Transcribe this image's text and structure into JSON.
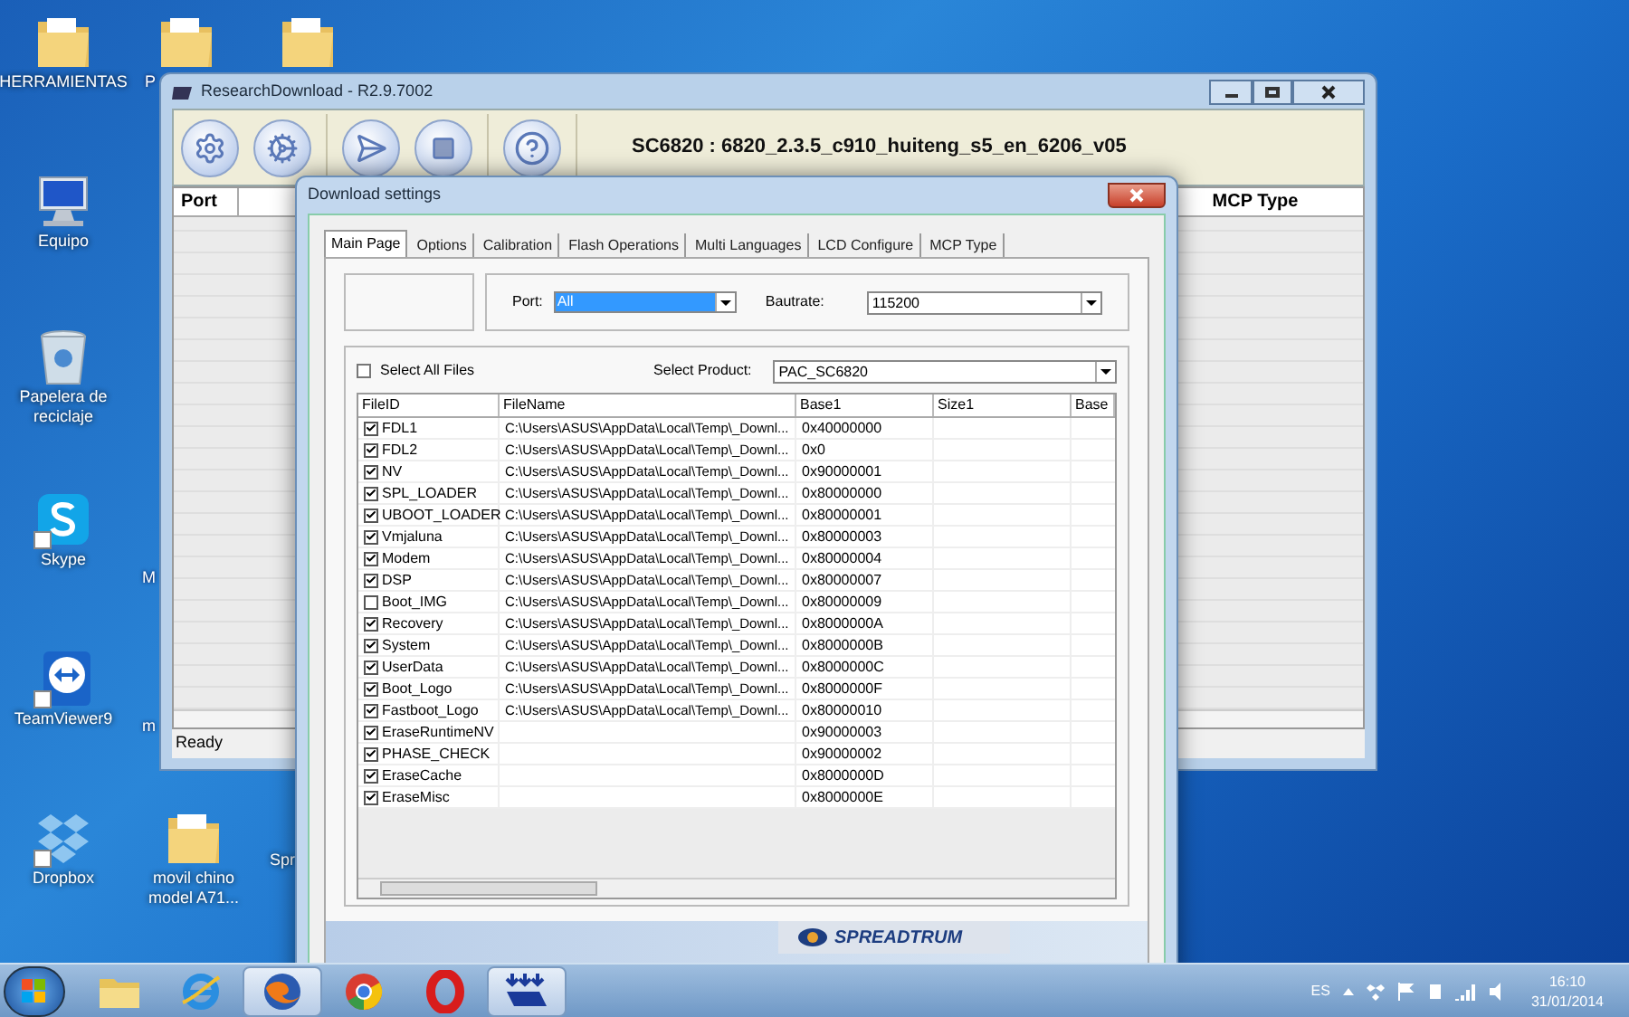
{
  "desktop_icons": [
    {
      "label": "HERRAMIENTAS",
      "kind": "folder-m"
    },
    {
      "label": "Equipo",
      "kind": "computer"
    },
    {
      "label": "Papelera de reciclaje",
      "kind": "recycle-bin"
    },
    {
      "label": "Skype",
      "kind": "skype"
    },
    {
      "label": "TeamViewer9",
      "kind": "teamviewer"
    },
    {
      "label": "Dropbox",
      "kind": "dropbox"
    }
  ],
  "desktop_icons_column_2": [
    {
      "label": "P",
      "kind": "folder"
    },
    {
      "label": "M",
      "kind": "none"
    },
    {
      "label": "m",
      "kind": "none"
    },
    {
      "label": "movil chino model A71...",
      "kind": "folder"
    }
  ],
  "desktop_icons_column_3": [
    {
      "kind": "folder"
    },
    {
      "label": "Spr",
      "kind": "none"
    }
  ],
  "main_window": {
    "title": "ResearchDownload - R2.9.7002",
    "toolbar": [
      {
        "kind": "settings"
      },
      {
        "kind": "gears"
      },
      {
        "kind": "start"
      },
      {
        "kind": "stop"
      },
      {
        "kind": "help"
      }
    ],
    "product_info": "SC6820 : 6820_2.3.5_c910_huiteng_s5_en_6206_v05",
    "columns": [
      "Port",
      "MCP Type"
    ],
    "status_bar": "Ready"
  },
  "dialog": {
    "title": "Download settings",
    "tabs": [
      {
        "label": "Main Page",
        "selected": true
      },
      {
        "label": "Options",
        "selected": false
      },
      {
        "label": "Calibration",
        "selected": false
      },
      {
        "label": "Flash Operations",
        "selected": false
      },
      {
        "label": "Multi Languages",
        "selected": false
      },
      {
        "label": "LCD Configure",
        "selected": false
      },
      {
        "label": "MCP Type",
        "selected": false
      }
    ],
    "port": {
      "label": "Port:",
      "value": "All"
    },
    "baudrate": {
      "label": "Bautrate:",
      "value": "115200"
    },
    "select_all": {
      "label": "Select All Files",
      "checked": false
    },
    "product": {
      "label": "Select Product:",
      "value": "PAC_SC6820"
    },
    "table": {
      "columns": [
        "FileID",
        "FileName",
        "Base1",
        "Size1",
        "Base"
      ],
      "rows": [
        {
          "file_id": "FDL1",
          "checked": true,
          "file_name": "C:\\Users\\ASUS\\AppData\\Local\\Temp\\_Downl...",
          "base1": "0x40000000"
        },
        {
          "file_id": "FDL2",
          "checked": true,
          "file_name": "C:\\Users\\ASUS\\AppData\\Local\\Temp\\_Downl...",
          "base1": "0x0"
        },
        {
          "file_id": "NV",
          "checked": true,
          "file_name": "C:\\Users\\ASUS\\AppData\\Local\\Temp\\_Downl...",
          "base1": "0x90000001"
        },
        {
          "file_id": "SPL_LOADER",
          "checked": true,
          "file_name": "C:\\Users\\ASUS\\AppData\\Local\\Temp\\_Downl...",
          "base1": "0x80000000"
        },
        {
          "file_id": "UBOOT_LOADER",
          "checked": true,
          "file_name": "C:\\Users\\ASUS\\AppData\\Local\\Temp\\_Downl...",
          "base1": "0x80000001"
        },
        {
          "file_id": "Vmjaluna",
          "checked": true,
          "file_name": "C:\\Users\\ASUS\\AppData\\Local\\Temp\\_Downl...",
          "base1": "0x80000003"
        },
        {
          "file_id": "Modem",
          "checked": true,
          "file_name": "C:\\Users\\ASUS\\AppData\\Local\\Temp\\_Downl...",
          "base1": "0x80000004"
        },
        {
          "file_id": "DSP",
          "checked": true,
          "file_name": "C:\\Users\\ASUS\\AppData\\Local\\Temp\\_Downl...",
          "base1": "0x80000007"
        },
        {
          "file_id": "Boot_IMG",
          "checked": false,
          "file_name": "C:\\Users\\ASUS\\AppData\\Local\\Temp\\_Downl...",
          "base1": "0x80000009"
        },
        {
          "file_id": "Recovery",
          "checked": true,
          "file_name": "C:\\Users\\ASUS\\AppData\\Local\\Temp\\_Downl...",
          "base1": "0x8000000A"
        },
        {
          "file_id": "System",
          "checked": true,
          "file_name": "C:\\Users\\ASUS\\AppData\\Local\\Temp\\_Downl...",
          "base1": "0x8000000B"
        },
        {
          "file_id": "UserData",
          "checked": true,
          "file_name": "C:\\Users\\ASUS\\AppData\\Local\\Temp\\_Downl...",
          "base1": "0x8000000C"
        },
        {
          "file_id": "Boot_Logo",
          "checked": true,
          "file_name": "C:\\Users\\ASUS\\AppData\\Local\\Temp\\_Downl...",
          "base1": "0x8000000F"
        },
        {
          "file_id": "Fastboot_Logo",
          "checked": true,
          "file_name": "C:\\Users\\ASUS\\AppData\\Local\\Temp\\_Downl...",
          "base1": "0x80000010"
        },
        {
          "file_id": "EraseRuntimeNV",
          "checked": true,
          "base1": "0x90000003"
        },
        {
          "file_id": "PHASE_CHECK",
          "checked": true,
          "base1": "0x90000002"
        },
        {
          "file_id": "EraseCache",
          "checked": true,
          "base1": "0x8000000D"
        },
        {
          "file_id": "EraseMisc",
          "checked": true,
          "base1": "0x8000000E"
        }
      ]
    },
    "banner_logo": "SPREADTRUM"
  },
  "taskbar": {
    "apps": [
      {
        "kind": "explorer",
        "active": false
      },
      {
        "kind": "ie",
        "active": false
      },
      {
        "kind": "firefox",
        "active": true
      },
      {
        "kind": "chrome",
        "active": false
      },
      {
        "kind": "opera",
        "active": false
      },
      {
        "kind": "download-tool",
        "active": true
      }
    ],
    "language": "ES",
    "time": "16:10",
    "date": "31/01/2014"
  }
}
